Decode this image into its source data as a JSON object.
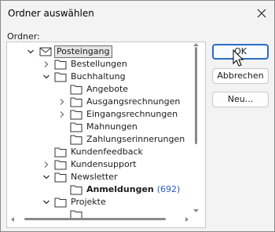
{
  "window": {
    "title": "Ordner auswählen"
  },
  "labels": {
    "folder": "Ordner:"
  },
  "tree": {
    "items": [
      {
        "label": "Posteingang",
        "selected": true,
        "expander": "open",
        "icon": "inbox-icon"
      },
      {
        "label": "Bestellungen",
        "expander": "closed",
        "icon": "folder-icon"
      },
      {
        "label": "Buchhaltung",
        "expander": "open",
        "icon": "folder-icon"
      },
      {
        "label": "Angebote",
        "expander": "none",
        "icon": "folder-icon"
      },
      {
        "label": "Ausgangsrechnungen",
        "expander": "closed",
        "icon": "folder-icon"
      },
      {
        "label": "Eingangsrechnungen",
        "expander": "closed",
        "icon": "folder-icon"
      },
      {
        "label": "Mahnungen",
        "expander": "none",
        "icon": "folder-icon"
      },
      {
        "label": "Zahlungserinnerungen",
        "expander": "none",
        "icon": "folder-icon"
      },
      {
        "label": "Kundenfeedback",
        "expander": "none",
        "icon": "folder-icon"
      },
      {
        "label": "Kundensupport",
        "expander": "closed",
        "icon": "folder-icon"
      },
      {
        "label": "Newsletter",
        "expander": "open",
        "icon": "folder-icon"
      },
      {
        "label": "Anmeldungen",
        "count": "(692)",
        "bold": true,
        "expander": "none",
        "icon": "folder-icon"
      },
      {
        "label": "Projekte",
        "expander": "open",
        "icon": "folder-icon"
      }
    ]
  },
  "buttons": {
    "ok": "OK",
    "cancel": "Abbrechen",
    "new": "Neu..."
  },
  "colors": {
    "accent": "#2b6cc4",
    "count": "#2b57c7"
  }
}
